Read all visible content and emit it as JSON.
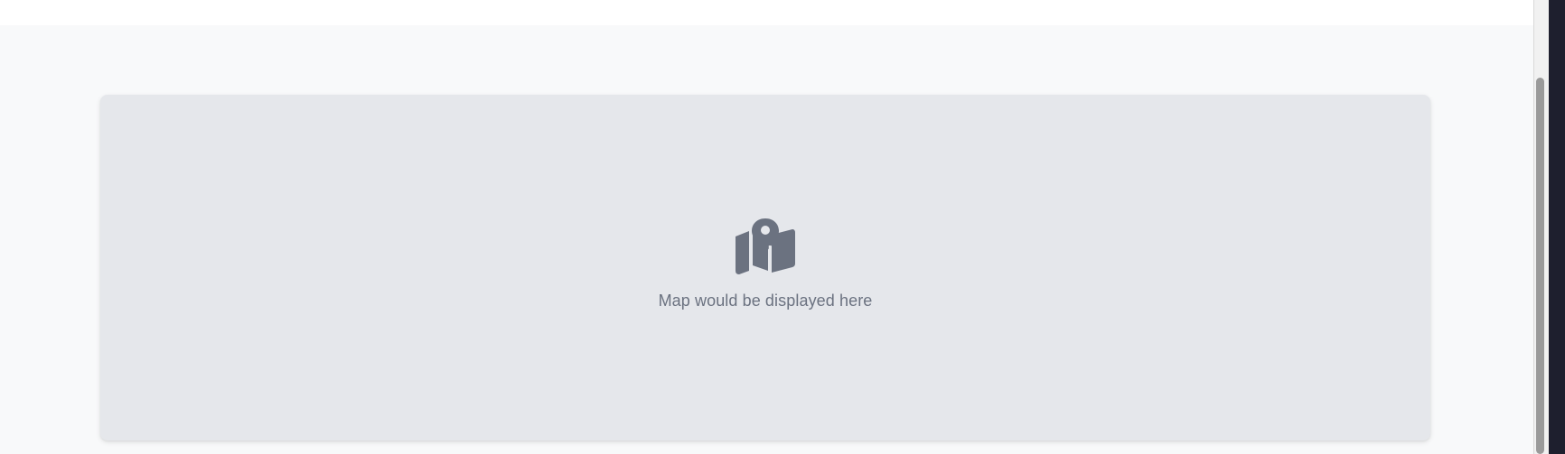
{
  "map": {
    "icon": "map-location-icon",
    "placeholder_text": "Map would be displayed here"
  },
  "colors": {
    "background": "#f8f9fa",
    "placeholder_bg": "#e5e7eb",
    "icon": "#6b7280",
    "text": "#6b7280"
  }
}
